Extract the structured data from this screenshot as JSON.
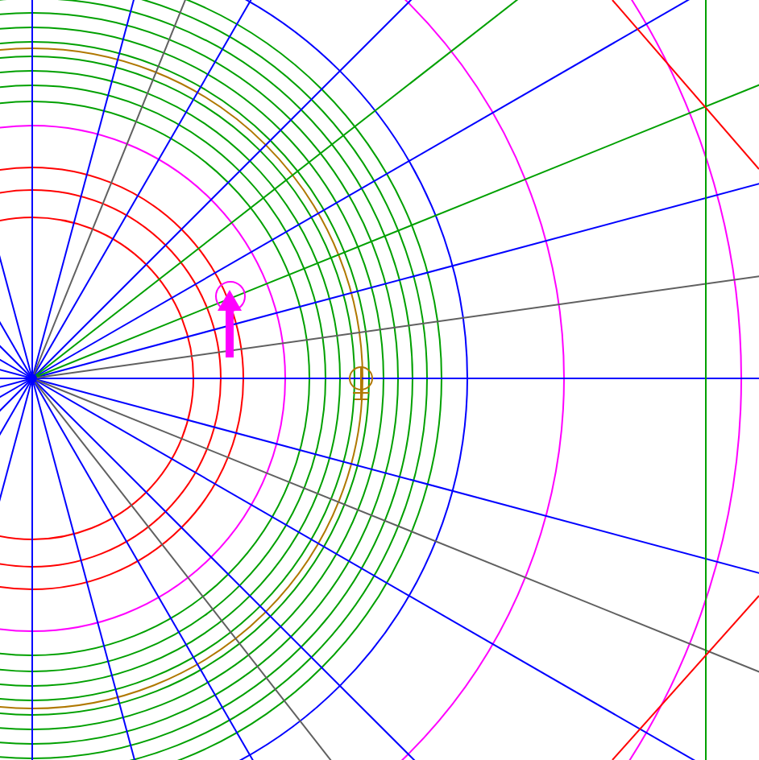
{
  "canvas": {
    "kind": "polar-diagram"
  }
}
